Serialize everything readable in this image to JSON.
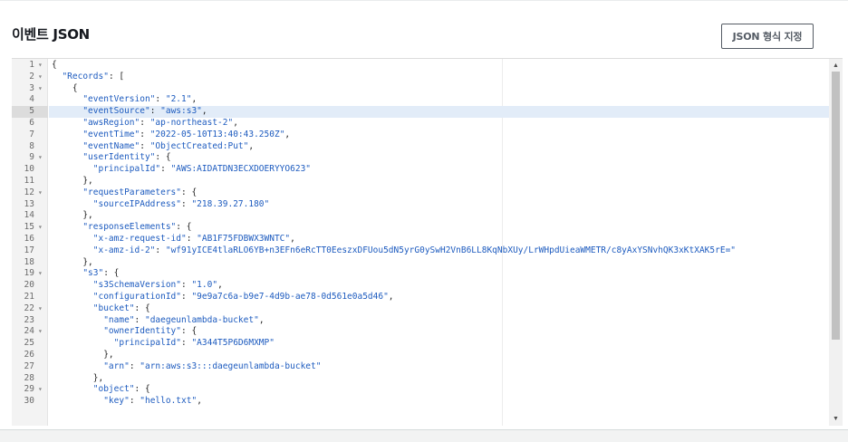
{
  "panel": {
    "title": "이벤트 JSON",
    "format_button": "JSON 형식 지정"
  },
  "editor": {
    "active_line": 5,
    "lines": [
      {
        "n": "1",
        "fold": true,
        "code": "{"
      },
      {
        "n": "2",
        "fold": true,
        "code": "  \"Records\": ["
      },
      {
        "n": "3",
        "fold": true,
        "code": "    {"
      },
      {
        "n": "4",
        "fold": false,
        "code": "      \"eventVersion\": \"2.1\","
      },
      {
        "n": "5",
        "fold": false,
        "code": "      \"eventSource\": \"aws:s3\","
      },
      {
        "n": "6",
        "fold": false,
        "code": "      \"awsRegion\": \"ap-northeast-2\","
      },
      {
        "n": "7",
        "fold": false,
        "code": "      \"eventTime\": \"2022-05-10T13:40:43.250Z\","
      },
      {
        "n": "8",
        "fold": false,
        "code": "      \"eventName\": \"ObjectCreated:Put\","
      },
      {
        "n": "9",
        "fold": true,
        "code": "      \"userIdentity\": {"
      },
      {
        "n": "10",
        "fold": false,
        "code": "        \"principalId\": \"AWS:AIDATDN3ECXDOERYYO623\""
      },
      {
        "n": "11",
        "fold": false,
        "code": "      },"
      },
      {
        "n": "12",
        "fold": true,
        "code": "      \"requestParameters\": {"
      },
      {
        "n": "13",
        "fold": false,
        "code": "        \"sourceIPAddress\": \"218.39.27.180\""
      },
      {
        "n": "14",
        "fold": false,
        "code": "      },"
      },
      {
        "n": "15",
        "fold": true,
        "code": "      \"responseElements\": {"
      },
      {
        "n": "16",
        "fold": false,
        "code": "        \"x-amz-request-id\": \"AB1F75FDBWX3WNTC\","
      },
      {
        "n": "17",
        "fold": false,
        "code": "        \"x-amz-id-2\": \"wf91yICE4tlaRLO6YB+n3EFn6eRcTT0EeszxDFUou5dN5yrG0ySwH2VnB6LL8KqNbXUy/LrWHpdUieaWMETR/c8yAxYSNvhQK3xKtXAK5rE=\""
      },
      {
        "n": "18",
        "fold": false,
        "code": "      },"
      },
      {
        "n": "19",
        "fold": true,
        "code": "      \"s3\": {"
      },
      {
        "n": "20",
        "fold": false,
        "code": "        \"s3SchemaVersion\": \"1.0\","
      },
      {
        "n": "21",
        "fold": false,
        "code": "        \"configurationId\": \"9e9a7c6a-b9e7-4d9b-ae78-0d561e0a5d46\","
      },
      {
        "n": "22",
        "fold": true,
        "code": "        \"bucket\": {"
      },
      {
        "n": "23",
        "fold": false,
        "code": "          \"name\": \"daegeunlambda-bucket\","
      },
      {
        "n": "24",
        "fold": true,
        "code": "          \"ownerIdentity\": {"
      },
      {
        "n": "25",
        "fold": false,
        "code": "            \"principalId\": \"A344T5P6D6MXMP\""
      },
      {
        "n": "26",
        "fold": false,
        "code": "          },"
      },
      {
        "n": "27",
        "fold": false,
        "code": "          \"arn\": \"arn:aws:s3:::daegeunlambda-bucket\""
      },
      {
        "n": "28",
        "fold": false,
        "code": "        },"
      },
      {
        "n": "29",
        "fold": true,
        "code": "        \"object\": {"
      },
      {
        "n": "30",
        "fold": false,
        "code": "          \"key\": \"hello.txt\","
      }
    ],
    "scrollbar": {
      "up_icon": "triangle-up-icon",
      "down_icon": "triangle-down-icon"
    }
  },
  "colors": {
    "key_string": "#1d5bbf",
    "active_line": "#e2ecf8",
    "button_border": "#545b64"
  }
}
